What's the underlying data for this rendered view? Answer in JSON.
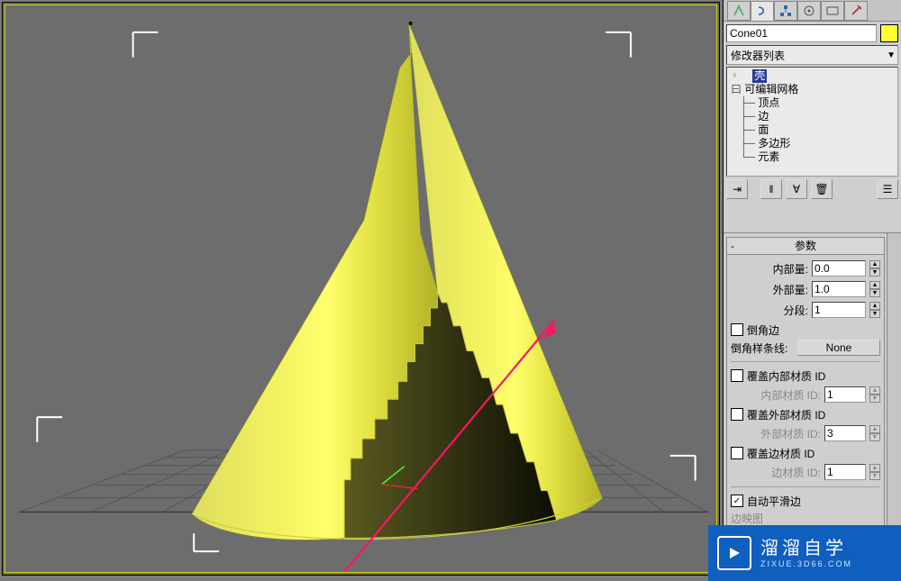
{
  "object_name": "Cone01",
  "modifier_dropdown": "修改器列表",
  "stack": {
    "top": "壳",
    "mesh": "可编辑网格",
    "subs": [
      "顶点",
      "边",
      "面",
      "多边形",
      "元素"
    ]
  },
  "rollout_params_title": "参数",
  "params": {
    "inner_label": "内部量:",
    "inner_val": "0.0",
    "outer_label": "外部量:",
    "outer_val": "1.0",
    "seg_label": "分段:",
    "seg_val": "1",
    "bevel_edges": "倒角边",
    "bevel_spline_label": "倒角样条线:",
    "bevel_spline_btn": "None",
    "override_inner": "覆盖内部材质 ID",
    "inner_id_label": "内部材质 ID:",
    "inner_id_val": "1",
    "override_outer": "覆盖外部材质 ID",
    "outer_id_label": "外部材质 ID:",
    "outer_id_val": "3",
    "override_edge": "覆盖边材质 ID",
    "edge_id_label": "边材质 ID:",
    "edge_id_val": "1",
    "autosmooth": "自动平滑边",
    "edge_map": "边映图"
  },
  "watermark": {
    "title": "溜溜自学",
    "sub": "ZIXUE.3D66.COM"
  },
  "tab_icons": [
    "pointer",
    "arc",
    "pin",
    "stack",
    "globe",
    "wrench",
    "hammer"
  ]
}
